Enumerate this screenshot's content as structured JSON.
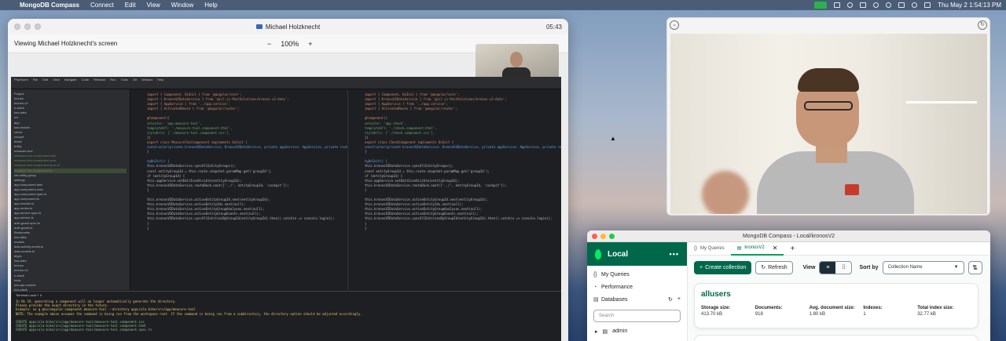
{
  "menubar": {
    "app": "MongoDB Compass",
    "items": [
      "Connect",
      "Edit",
      "View",
      "Window",
      "Help"
    ],
    "datetime": "Thu May 2   1:54:13 PM"
  },
  "share_window": {
    "title": "Michael Holzknecht",
    "time": "05:43",
    "viewing": "Viewing Michael Holzknecht's screen",
    "zoom_minus": "−",
    "zoom_value": "100%",
    "zoom_plus": "+"
  },
  "ide": {
    "menu": [
      "PhpStorm",
      "File",
      "Edit",
      "View",
      "Navigate",
      "Code",
      "Refactor",
      "Run",
      "Tools",
      "Git",
      "Window",
      "Help"
    ],
    "project_tree": [
      "Project",
      "kronos",
      "kronos-v2",
      "e-stack",
      "kna-data",
      "src",
      "app",
      "kna-header",
      "check",
      "cockpit",
      "detail",
      "entity",
      "measure-tool",
      "measure-tool.component.html",
      "measure-tool.component.scss",
      "measure-tool.component.spec.ts",
      "measure-tool.component.ts",
      "set-entity-group",
      "settings",
      "app.component.html",
      "app.component.scss",
      "app.component.spec.ts",
      "app.component.ts",
      "app.module.ts",
      "app.routes.ts",
      "app.service.spec.ts",
      "app.service.ts",
      "auth.guard.spec.ts",
      "auth.guard.ts",
      "Bookmarks",
      "kna-data",
      "models",
      "data.activity.model.ts",
      "data.models.ts",
      "dtyps",
      "kna-data",
      "kronos",
      "kronos-v2",
      "e-stack",
      "tools",
      "kna-api-models",
      "kna-stack",
      "kna-entity"
    ],
    "code_left": [
      "import { Component, OnInit } from '@angular/core';",
      "import { KronosV2DataService } from '@cil-js-PostSolutions/kronos-v2-data';",
      "import { AppService } from '../app.service';",
      "import { ActivatedRoute } from '@angular/router';",
      "",
      "@Component({",
      "  selector: 'app-measure-tool',",
      "  templateUrl: './measure-tool.component.html',",
      "  styleUrls: ['./measure-tool.component.css'],",
      "})",
      "export class MeasureToolComponent implements OnInit {",
      "  constructor(private kronosV2DataService: KronosV2DataService, private appService: AppService, private route: ActivatedRoute) {",
      "  }",
      "",
      "  ngOnInit() {",
      "    this.kronosV2DataService.syncAllEntityGroups();",
      "    const entityGroupId = this.route.snapshot.paramMap.get('groupId');",
      "    if (entityGroupId) {",
      "      this.appService.setEditIconVisible(entityGroupId);",
      "      this.kronosV2DataService.routeBack.next(['../', entityGroupId, 'cockpit']);",
      "    }",
      "",
      "    this.kronosV2DataService.activeEntityGroupId.next(entityGroupId);",
      "    this.kronosV2DataService.activeEntityIds.next(null);",
      "    this.kronosV2DataService.activeEntityGroupAnalyses.next(null);",
      "    this.kronosV2DataService.activeEntityGroupEvents.next(null);",
      "    this.kronosV2DataService.syncAllEntitiesByGroupId(entityGroupId).then().catch(e => console.log(e));",
      "  }",
      "}"
    ],
    "code_right": [
      "import { Component, OnInit } from '@angular/core';",
      "import { KronosV2DataService } from '@cil-js-PostSolutions/kronos-v2-data';",
      "import { AppService } from '../app.service';",
      "import { ActivatedRoute } from '@angular/router';",
      "",
      "@Component({",
      "  selector: 'app-check',",
      "  templateUrl: './check.component.html',",
      "  styleUrls: ['./check.component.css'],",
      "})",
      "export class CheckComponent implements OnInit {",
      "  constructor(private kronosV2DataService: KronosV2DataService, private appService: AppService, private route: ActivatedRoute) {",
      "  }",
      "",
      "  ngOnInit() {",
      "    this.kronosV2DataService.syncAllEntityGroups();",
      "    const entityGroupId = this.route.snapshot.paramMap.get('groupId');",
      "    if (entityGroupId) {",
      "      this.appService.setEditIconVisible(entityGroupId);",
      "      this.kronosV2DataService.routeBack.next(['../', entityGroupId, 'cockpit']);",
      "    }",
      "",
      "    this.kronosV2DataService.activeEntityGroupId.next(entityGroupId);",
      "    this.kronosV2DataService.activeEntityIds.next(null);",
      "    this.kronosV2DataService.activeEntityGroupAnalyses.next(null);",
      "    this.kronosV2DataService.activeEntityGroupEvents.next(null);",
      "    this.kronosV2DataService.syncAllEntitiesByGroupId(entityGroupId).then().catch(e => console.log(e));",
      "  }",
      "}"
    ],
    "terminal_tabs": "Terminal   Local  +  ∨",
    "terminal_lines": [
      "In Nx 19, generating a component will no longer automatically generate the directory.",
      "Please provide the exact directory in the future.",
      "Example: nx g @nx/angular:component measure-tool --directory apps/ula-bike/src/app/measure-tool",
      "NOTE: The example above assumes the command is being run from the workspace root. If the command is being run from a subdirectory, the directory option should be adjusted accordingly.",
      "",
      "CREATE apps/ula-bike/src/app/measure-tool/measure-tool.component.css",
      "CREATE apps/ula-bike/src/app/measure-tool/measure-tool.component.html",
      "CREATE apps/ula-bike/src/app/measure-tool/measure-tool.component.spec.ts"
    ]
  },
  "compass": {
    "window_title": "MongoDB Compass - Local/kronosV2",
    "connection": "Local",
    "nav": {
      "my_queries": "My Queries",
      "performance": "Performance",
      "databases": "Databases"
    },
    "search_placeholder": "Search",
    "db_item": "admin",
    "tabs": {
      "my_queries": "My Queries",
      "active": "kronosV2"
    },
    "toolbar": {
      "create": "Create collection",
      "refresh": "Refresh",
      "view_label": "View",
      "sort_label": "Sort by",
      "sort_value": "Collection Name"
    },
    "collection": {
      "name": "allusers",
      "stats": [
        {
          "label": "Storage size:",
          "value": "413.70 kB"
        },
        {
          "label": "Documents:",
          "value": "918"
        },
        {
          "label": "Avg. document size:",
          "value": "1.80 kB"
        },
        {
          "label": "Indexes:",
          "value": "1"
        },
        {
          "label": "Total index size:",
          "value": "32.77 kB"
        }
      ]
    }
  },
  "colors": {
    "brand_green": "#00684a",
    "leaf_green": "#00ed64",
    "facetime_green": "#2bb34b"
  }
}
